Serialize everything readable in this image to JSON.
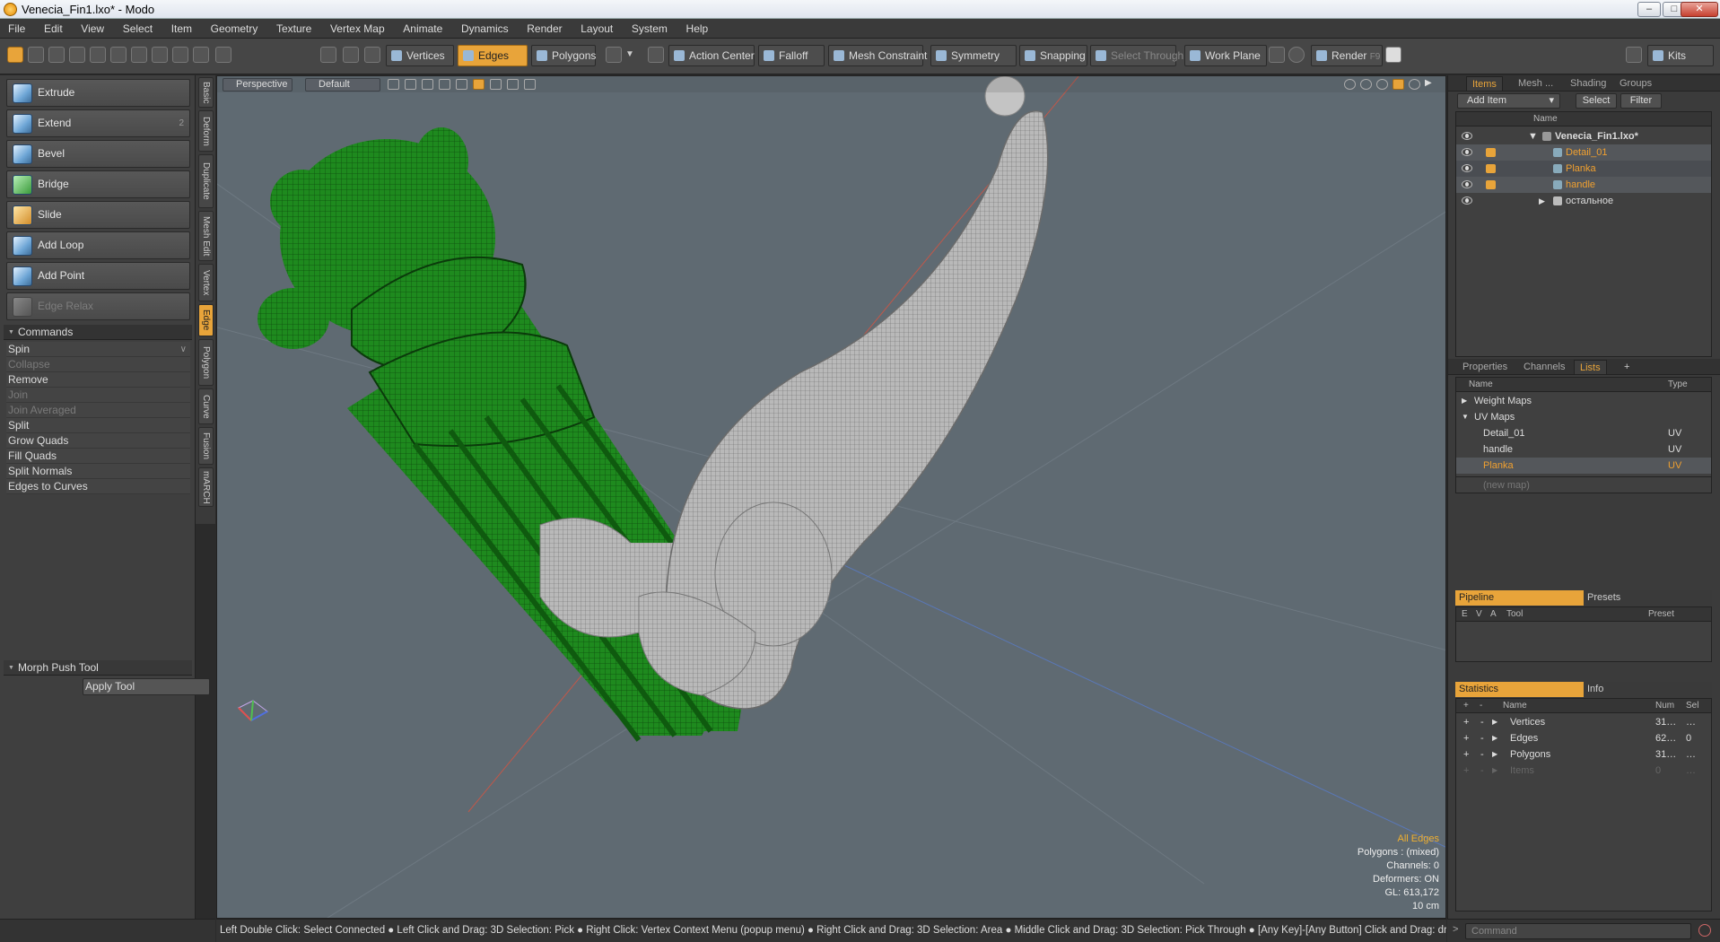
{
  "window": {
    "title": "Venecia_Fin1.lxo* - Modo",
    "min": "–",
    "max": "□",
    "close": "✕"
  },
  "menu": [
    "File",
    "Edit",
    "View",
    "Select",
    "Item",
    "Geometry",
    "Texture",
    "Vertex Map",
    "Animate",
    "Dynamics",
    "Render",
    "Layout",
    "System",
    "Help"
  ],
  "toolbar": {
    "vertices": "Vertices",
    "edges": "Edges",
    "polygons": "Polygons",
    "action_center": "Action Center",
    "falloff": "Falloff",
    "mesh_constraint": "Mesh Constraint",
    "symmetry": "Symmetry",
    "snapping": "Snapping",
    "select_through": "Select Through",
    "work_plane": "Work Plane",
    "render": "Render",
    "render_key": "F9",
    "kits": "Kits"
  },
  "left_tools": {
    "buttons": [
      {
        "label": "Extrude",
        "num": ""
      },
      {
        "label": "Extend",
        "num": "2"
      },
      {
        "label": "Bevel",
        "num": ""
      },
      {
        "label": "Bridge",
        "num": ""
      },
      {
        "label": "Slide",
        "num": ""
      },
      {
        "label": "Add Loop",
        "num": ""
      },
      {
        "label": "Add Point",
        "num": ""
      },
      {
        "label": "Edge Relax",
        "num": ""
      }
    ],
    "commands_header": "Commands",
    "commands": [
      {
        "label": "Spin",
        "dim": false
      },
      {
        "label": "Collapse",
        "dim": true
      },
      {
        "label": "Remove",
        "dim": false
      },
      {
        "label": "Join",
        "dim": true
      },
      {
        "label": "Join Averaged",
        "dim": true
      },
      {
        "label": "Split",
        "dim": false
      },
      {
        "label": "Grow Quads",
        "dim": false
      },
      {
        "label": "Fill Quads",
        "dim": false
      },
      {
        "label": "Split Normals",
        "dim": false
      },
      {
        "label": "Edges to Curves",
        "dim": false
      }
    ],
    "morph_header": "Morph Push Tool",
    "apply": "Apply Tool"
  },
  "vtabs": [
    "Basic",
    "Deform",
    "Duplicate",
    "Mesh Edit",
    "Vertex",
    "Edge",
    "Polygon",
    "Curve",
    "Fusion",
    "mARCH"
  ],
  "viewport": {
    "view": "Perspective",
    "shading": "Default",
    "selection_mode": "All Edges",
    "info": [
      "Polygons : (mixed)",
      "Channels: 0",
      "Deformers: ON",
      "GL: 613,172",
      "10 cm"
    ]
  },
  "items_panel": {
    "tabs": [
      "Items",
      "Mesh ...",
      "Shading",
      "Groups"
    ],
    "add_item": "Add Item",
    "select": "Select",
    "filter": "Filter",
    "col_name": "Name",
    "rows": [
      {
        "name": "Venecia_Fin1.lxo*"
      },
      {
        "name": "Detail_01"
      },
      {
        "name": "Planka"
      },
      {
        "name": "handle"
      },
      {
        "name": "остальное"
      }
    ]
  },
  "lists_panel": {
    "tabs": [
      "Properties",
      "Channels",
      "Lists"
    ],
    "plus": "+",
    "col_name": "Name",
    "col_type": "Type",
    "rows": [
      {
        "name": "Weight Maps",
        "type": ""
      },
      {
        "name": "UV Maps",
        "type": ""
      },
      {
        "name": "Detail_01",
        "type": "UV"
      },
      {
        "name": "handle",
        "type": "UV"
      },
      {
        "name": "Planka",
        "type": "UV"
      },
      {
        "name": "(new map)",
        "type": ""
      }
    ]
  },
  "pipeline_panel": {
    "tabs": [
      "Pipeline",
      "Presets"
    ],
    "cols": {
      "e": "E",
      "v": "V",
      "a": "A",
      "tool": "Tool",
      "preset": "Preset"
    }
  },
  "stats_panel": {
    "tabs": [
      "Statistics",
      "Info"
    ],
    "cols": {
      "plus": "+",
      "minus": "-",
      "name": "Name",
      "num": "Num",
      "sel": "Sel"
    },
    "rows": [
      {
        "name": "Vertices",
        "num": "31…",
        "sel": "…"
      },
      {
        "name": "Edges",
        "num": "62…",
        "sel": "0"
      },
      {
        "name": "Polygons",
        "num": "31…",
        "sel": "…"
      },
      {
        "name": "Items",
        "num": "0",
        "sel": "…"
      }
    ]
  },
  "status": "Left Double Click: Select Connected ● Left Click and Drag: 3D Selection: Pick ● Right Click: Vertex Context Menu (popup menu) ● Right Click and Drag: 3D Selection: Area ● Middle Click and Drag: 3D Selection: Pick Through ● [Any Key]-[Any Button] Click and Drag: dragDropBegin",
  "command_placeholder": "Command",
  "colors": {
    "accent": "#e8a43a",
    "mesh_green": "#1f8a1f",
    "viewport_bg": "#5f6a72"
  }
}
